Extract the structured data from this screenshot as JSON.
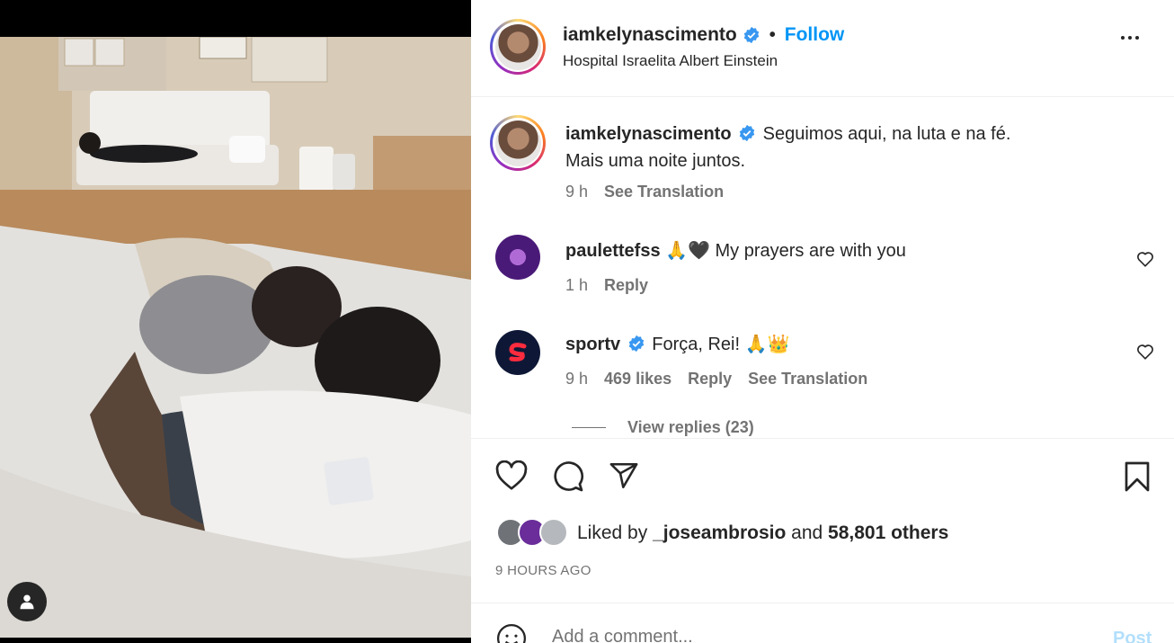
{
  "post": {
    "author": "iamkelynascimento",
    "follow_label": "Follow",
    "location": "Hospital Israelita Albert Einstein",
    "caption_user": "iamkelynascimento",
    "caption_line1": "Seguimos aqui, na luta e na fé.",
    "caption_line2": "Mais uma noite juntos.",
    "caption_time": "9 h",
    "see_translation": "See Translation"
  },
  "comments": [
    {
      "user": "paulettefss",
      "text": "🙏🖤 My prayers are with you",
      "time": "1 h",
      "reply": "Reply"
    },
    {
      "user": "sportv",
      "text": "Força, Rei! 🙏👑",
      "time": "9 h",
      "likes": "469 likes",
      "reply": "Reply",
      "see_translation": "See Translation",
      "view_replies": "View replies (23)"
    }
  ],
  "likes": {
    "prefix": "Liked by",
    "user": "_joseambrosio",
    "and": "and",
    "others": "58,801 others"
  },
  "time_ago": "9 HOURS AGO",
  "add_comment": {
    "placeholder": "Add a comment...",
    "post_label": "Post"
  },
  "colors": {
    "accent": "#0095f6",
    "verified": "#3897f0",
    "secondary_text": "#737373"
  },
  "icons": [
    "user-tag-icon",
    "more-icon",
    "verified-badge-icon",
    "heart-icon",
    "comment-icon",
    "share-icon",
    "bookmark-icon",
    "emoji-icon"
  ]
}
